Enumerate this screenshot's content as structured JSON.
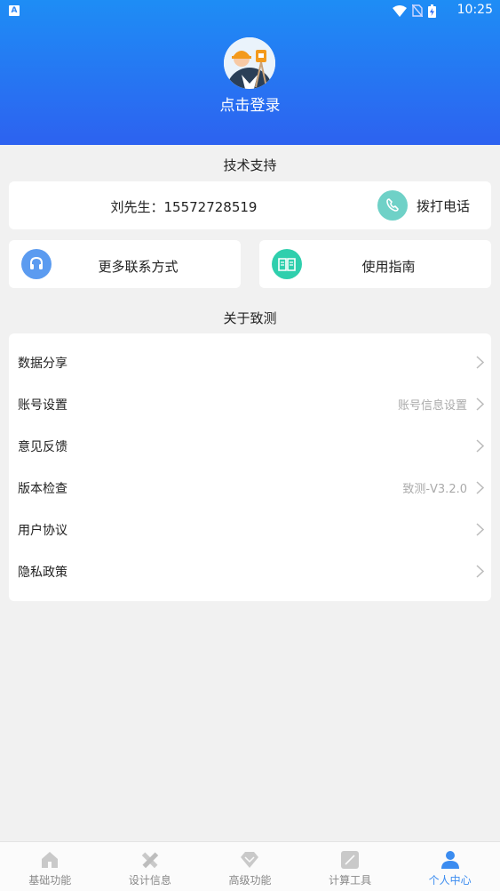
{
  "status_bar": {
    "app_badge": "A",
    "time": "10:25"
  },
  "header": {
    "login_text": "点击登录"
  },
  "support": {
    "title": "技术支持",
    "contact": "刘先生：15572728519",
    "call_label": "拨打电话",
    "more_contact_label": "更多联系方式",
    "guide_label": "使用指南"
  },
  "about": {
    "title": "关于致测",
    "items": [
      {
        "label": "数据分享",
        "value": ""
      },
      {
        "label": "账号设置",
        "value": "账号信息设置"
      },
      {
        "label": "意见反馈",
        "value": ""
      },
      {
        "label": "版本检查",
        "value": "致测-V3.2.0"
      },
      {
        "label": "用户协议",
        "value": ""
      },
      {
        "label": "隐私政策",
        "value": ""
      }
    ]
  },
  "nav": {
    "items": [
      {
        "label": "基础功能",
        "icon": "house-icon"
      },
      {
        "label": "设计信息",
        "icon": "pencil-ruler-icon"
      },
      {
        "label": "高级功能",
        "icon": "diamond-icon"
      },
      {
        "label": "计算工具",
        "icon": "calculator-icon"
      },
      {
        "label": "个人中心",
        "icon": "person-icon"
      }
    ],
    "active_index": 4
  },
  "colors": {
    "header_top": "#1e8df5",
    "header_bottom": "#2d62f0",
    "active": "#3b8cf0",
    "call_icon_bg": "#6fd1c7",
    "guide_icon_bg": "#2fcfad",
    "more_icon_bg": "#5b9bf0"
  }
}
